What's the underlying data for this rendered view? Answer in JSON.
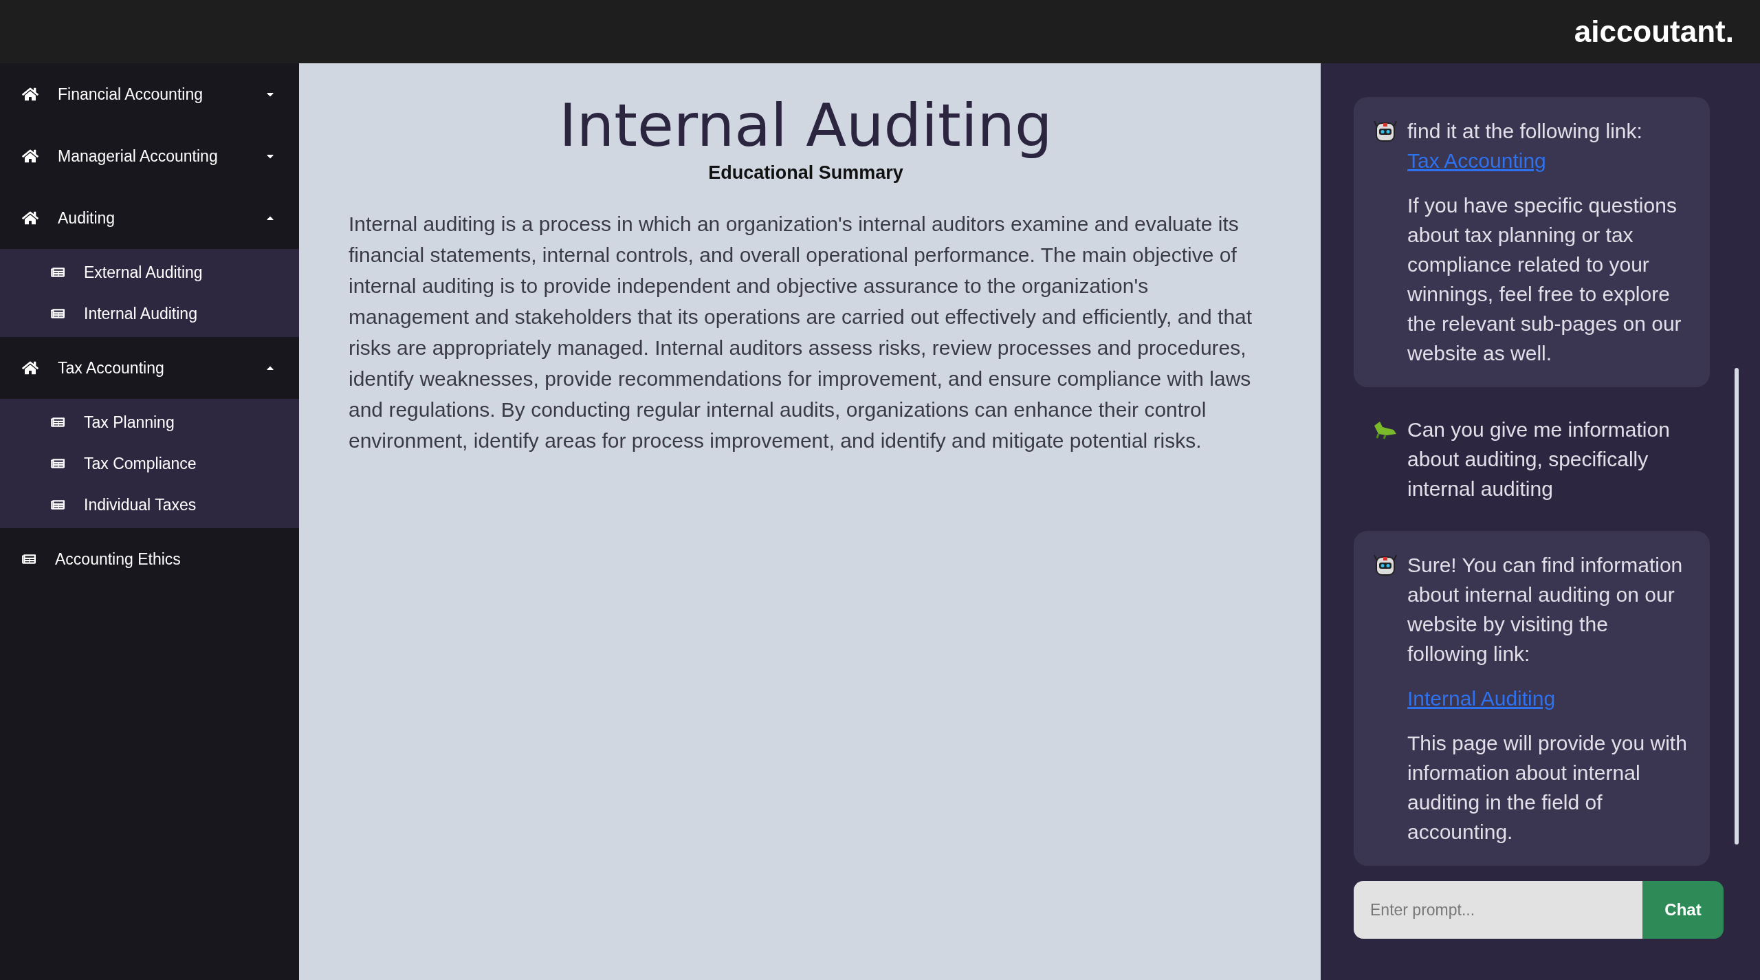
{
  "header": {
    "logo": "aiccoutant."
  },
  "sidebar": {
    "items": [
      {
        "kind": "group",
        "label": "Financial Accounting",
        "expanded": false
      },
      {
        "kind": "group",
        "label": "Managerial Accounting",
        "expanded": false
      },
      {
        "kind": "group",
        "label": "Auditing",
        "expanded": true,
        "children": [
          {
            "kind": "page",
            "label": "External Auditing"
          },
          {
            "kind": "page",
            "label": "Internal Auditing"
          }
        ]
      },
      {
        "kind": "group",
        "label": "Tax Accounting",
        "expanded": true,
        "children": [
          {
            "kind": "page",
            "label": "Tax Planning"
          },
          {
            "kind": "page",
            "label": "Tax Compliance"
          },
          {
            "kind": "page",
            "label": "Individual Taxes"
          }
        ]
      },
      {
        "kind": "page",
        "label": "Accounting Ethics"
      }
    ]
  },
  "article": {
    "title": "Internal Auditing",
    "subtitle": "Educational Summary",
    "body": "Internal auditing is a process in which an organization's internal auditors examine and evaluate its financial statements, internal controls, and overall operational performance. The main objective of internal auditing is to provide independent and objective assurance to the organization's management and stakeholders that its operations are carried out effectively and efficiently, and that risks are appropriately managed. Internal auditors assess risks, review processes and procedures, identify weaknesses, provide recommendations for improvement, and ensure compliance with laws and regulations. By conducting regular internal audits, organizations can enhance their control environment, identify areas for process improvement, and identify and mitigate potential risks."
  },
  "chat": {
    "messages": [
      {
        "kind": "bot",
        "paragraphs": [
          {
            "text": "find it at the following link:",
            "link": "Tax Accounting"
          },
          {
            "text": "If you have specific questions about tax planning or tax compliance related to your winnings, feel free to explore the relevant sub-pages on our website as well."
          }
        ]
      },
      {
        "kind": "user",
        "paragraphs": [
          {
            "text": "Can you give me information about auditing, specifically internal auditing"
          }
        ]
      },
      {
        "kind": "bot",
        "paragraphs": [
          {
            "text": "Sure! You can find information about internal auditing on our website by visiting the following link:"
          },
          {
            "link": "Internal Auditing"
          },
          {
            "text": "This page will provide you with information about internal auditing in the field of accounting."
          }
        ]
      }
    ],
    "input": {
      "placeholder": "Enter prompt..."
    },
    "button": "Chat"
  }
}
